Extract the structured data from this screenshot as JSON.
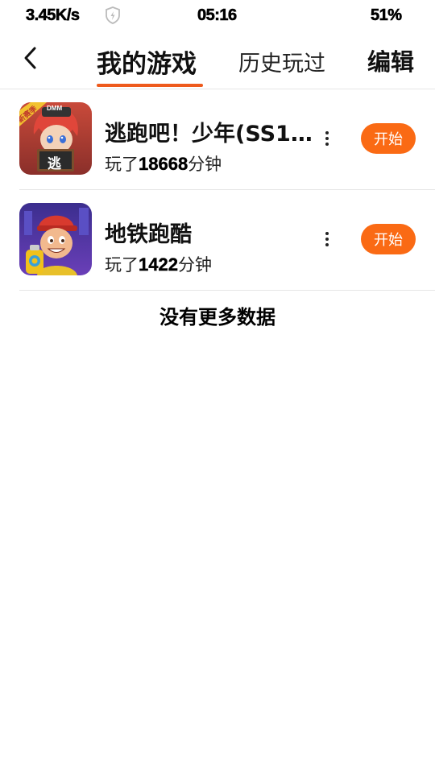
{
  "status_bar": {
    "net_speed": "3.45K/s",
    "time": "05:16",
    "battery": "51%",
    "shield_icon": "shield-bolt-icon"
  },
  "header": {
    "back_icon": "chevron-left-icon",
    "tabs": [
      {
        "label": "我的游戏",
        "active": true
      },
      {
        "label": "历史玩过",
        "active": false
      }
    ],
    "edit_label": "编辑"
  },
  "colors": {
    "accent": "#ee5a1c",
    "start_button": "#fa6a14"
  },
  "games": [
    {
      "title": "逃跑吧！少年(SS1...",
      "playtime_prefix": "玩了",
      "playtime_minutes": "18668",
      "playtime_suffix": "分钟",
      "start_label": "开始",
      "badge_text": "新赛季",
      "icon_caption": "逃",
      "icon_tag": "DMM",
      "more_icon": "more-vertical-icon"
    },
    {
      "title": "地铁跑酷",
      "playtime_prefix": "玩了",
      "playtime_minutes": "1422",
      "playtime_suffix": "分钟",
      "start_label": "开始",
      "more_icon": "more-vertical-icon"
    }
  ],
  "footer_text": "没有更多数据"
}
